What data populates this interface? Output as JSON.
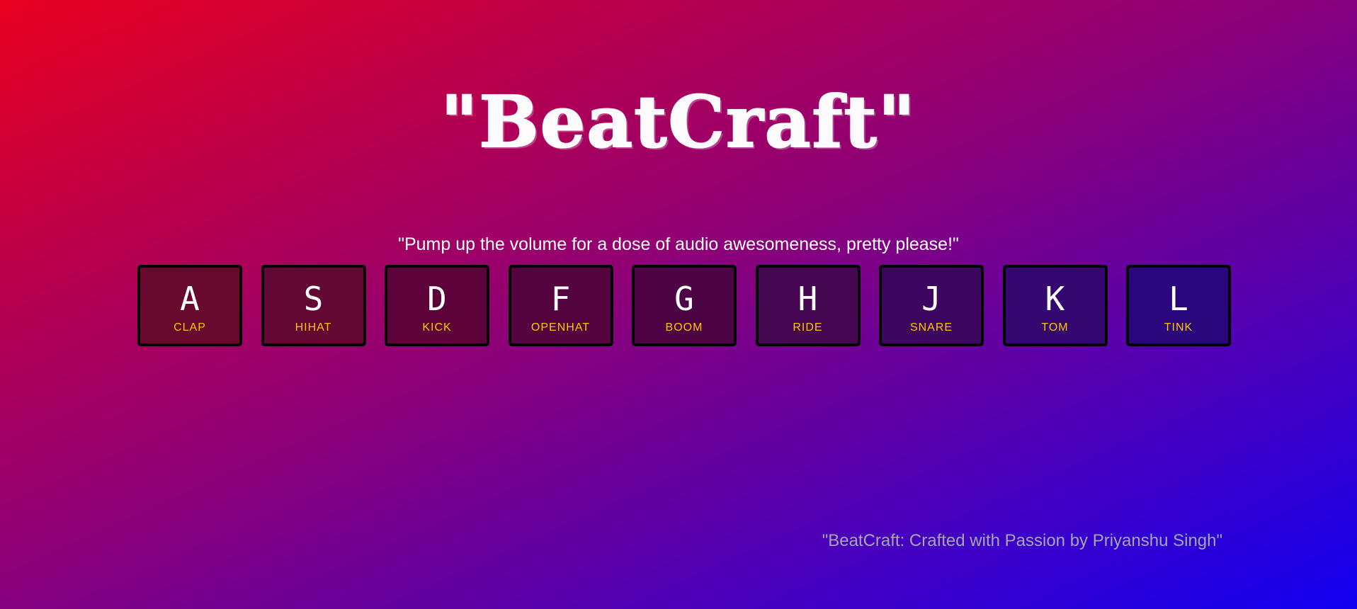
{
  "header": {
    "title": "\"BeatCraft\""
  },
  "tagline": "\"Pump up the volume for a dose of audio awesomeness, pretty please!\"",
  "keys": [
    {
      "letter": "A",
      "sound": "CLAP",
      "color": "#680a2d"
    },
    {
      "letter": "S",
      "sound": "HIHAT",
      "color": "#630733"
    },
    {
      "letter": "D",
      "sound": "KICK",
      "color": "#5c043a"
    },
    {
      "letter": "F",
      "sound": "OPENHAT",
      "color": "#55043f"
    },
    {
      "letter": "G",
      "sound": "BOOM",
      "color": "#4d0445"
    },
    {
      "letter": "H",
      "sound": "RIDE",
      "color": "#450652"
    },
    {
      "letter": "J",
      "sound": "SNARE",
      "color": "#3d0660"
    },
    {
      "letter": "K",
      "sound": "TOM",
      "color": "#340870"
    },
    {
      "letter": "L",
      "sound": "TINK",
      "color": "#2a077c"
    }
  ],
  "footer": {
    "credit": "\"BeatCraft: Crafted with Passion by Priyanshu Singh\""
  },
  "colors": {
    "gradient_start": "#e8001f",
    "gradient_mid": "#8a007a",
    "gradient_end": "#1200f2",
    "key_border": "#000000",
    "key_label": "#ffc600",
    "credit_text": "#a6a6b0"
  }
}
